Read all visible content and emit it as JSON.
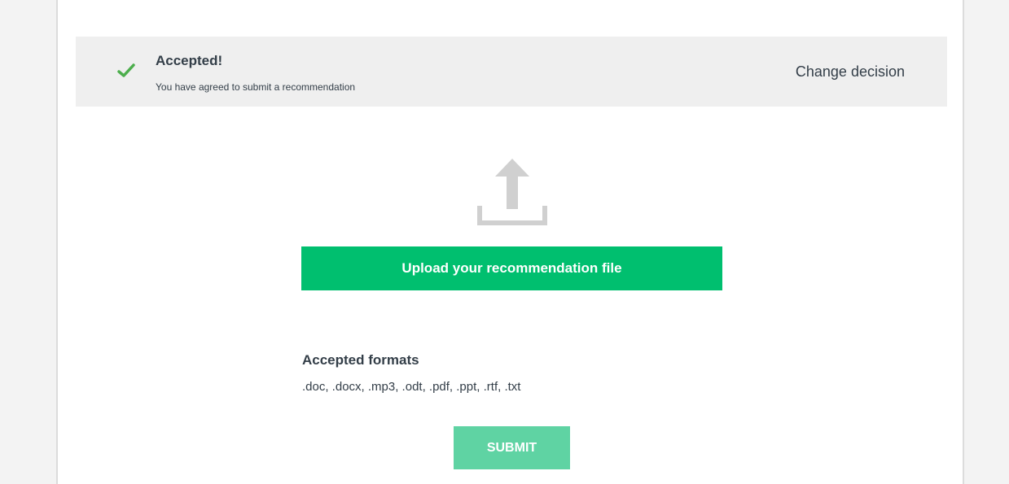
{
  "decision": {
    "title": "Accepted!",
    "subtitle": "You have agreed to submit a recommendation",
    "change_label": "Change decision"
  },
  "upload": {
    "button_label": "Upload your recommendation file"
  },
  "formats": {
    "title": "Accepted formats",
    "list": ".doc, .docx, .mp3, .odt, .pdf, .ppt, .rtf, .txt"
  },
  "submit": {
    "label": "SUBMIT"
  },
  "colors": {
    "accent": "#00bf6f",
    "accent_disabled": "#5fd3a3",
    "check": "#4cae4c",
    "upload_icon": "#d0d0d0"
  },
  "icons": {
    "check": "check-icon",
    "upload": "upload-icon"
  }
}
